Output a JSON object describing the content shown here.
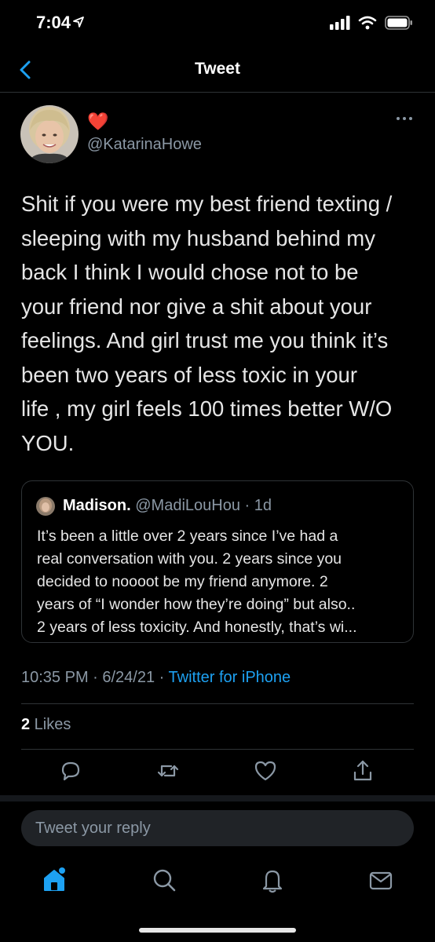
{
  "status_bar": {
    "time": "7:04",
    "location_icon": "location-arrow-icon",
    "signal_icon": "signal-bars-icon",
    "wifi_icon": "wifi-icon",
    "battery_icon": "battery-icon"
  },
  "nav": {
    "title": "Tweet",
    "back_icon": "chevron-left-icon"
  },
  "tweet": {
    "display_name": "❤️",
    "handle": "@KatarinaHowe",
    "text_lines": [
      "Shit if you were my best friend texting /",
      "sleeping with my husband behind my",
      "back I think I would chose not to be",
      "your friend nor give a shit about your",
      "feelings. And girl trust me you think it’s",
      "been two years of less toxic in your",
      "life , my girl feels 100 times better W/O",
      "YOU."
    ],
    "more_icon": "more-horizontal-icon"
  },
  "quote": {
    "name": "Madison.",
    "handle": "@MadiLouHou · 1d",
    "text_lines": [
      "It’s been a little over 2 years since I’ve had a",
      "real conversation with you. 2 years since you",
      "decided to noooot be my friend anymore. 2",
      "years of “I wonder how they’re doing” but also..",
      "2 years of less toxicity. And honestly, that’s wi..."
    ]
  },
  "meta": {
    "timestamp": "10:35 PM · 6/24/21 · ",
    "source": "Twitter for iPhone"
  },
  "likes": {
    "count": "2",
    "label": " Likes"
  },
  "actions": [
    "reply-icon",
    "retweet-icon",
    "like-icon",
    "share-icon"
  ],
  "reply": {
    "placeholder": "Tweet your reply"
  },
  "tabs": [
    "home-icon",
    "search-icon",
    "notifications-icon",
    "messages-icon"
  ],
  "colors": {
    "accent": "#1da1f2",
    "background": "#000000",
    "muted": "#8b98a5",
    "border": "#2f3336"
  }
}
